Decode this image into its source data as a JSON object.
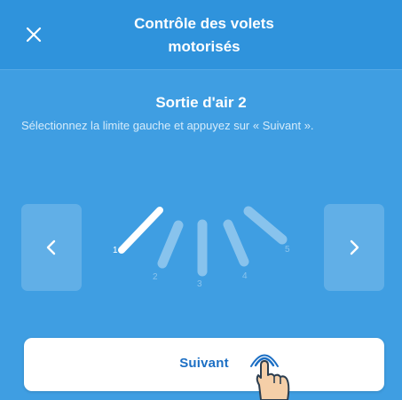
{
  "header": {
    "title_line1": "Contrôle des volets",
    "title_line2": "motorisés",
    "close_icon": "close-icon"
  },
  "section": {
    "title": "Sortie d'air 2",
    "instruction": "Sélectionnez la limite gauche et appuyez sur « Suivant »."
  },
  "selector": {
    "prev_icon": "chevron-left-icon",
    "next_icon": "chevron-right-icon",
    "positions": [
      "1",
      "2",
      "3",
      "4",
      "5"
    ],
    "selected": "1"
  },
  "footer": {
    "next_label": "Suivant"
  },
  "colors": {
    "background": "#3f9ee2",
    "header": "#2f93dc",
    "button_text": "#1c6fc4"
  }
}
